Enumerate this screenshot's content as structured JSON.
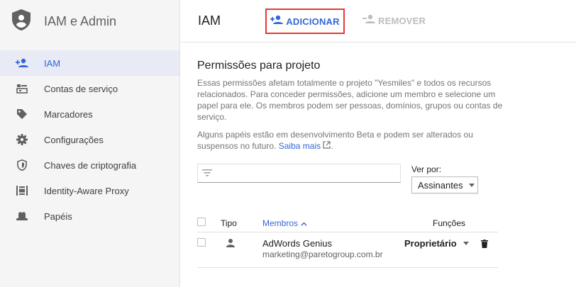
{
  "sidebar": {
    "title": "IAM e Admin",
    "items": [
      {
        "label": "IAM",
        "icon": "person-add-icon"
      },
      {
        "label": "Contas de serviço",
        "icon": "service-account-icon"
      },
      {
        "label": "Marcadores",
        "icon": "label-icon"
      },
      {
        "label": "Configurações",
        "icon": "gear-icon"
      },
      {
        "label": "Chaves de criptografia",
        "icon": "shield-icon"
      },
      {
        "label": "Identity-Aware Proxy",
        "icon": "proxy-icon"
      },
      {
        "label": "Papéis",
        "icon": "hat-icon"
      }
    ]
  },
  "header": {
    "title": "IAM",
    "add_label": "ADICIONAR",
    "remove_label": "REMOVER"
  },
  "main": {
    "section_title": "Permissões para projeto",
    "description": "Essas permissões afetam totalmente o projeto \"Yesmiles\" e todos os recursos relacionados. Para conceder permissões, adicione um membro e selecione um papel para ele. Os membros podem ser pessoas, domínios, grupos ou contas de serviço.",
    "beta_note": "Alguns papéis estão em desenvolvimento Beta e podem ser alterados ou suspensos no futuro.",
    "learn_more": "Saiba mais",
    "view_by_label": "Ver por:",
    "view_by_value": "Assinantes"
  },
  "table": {
    "columns": {
      "type": "Tipo",
      "members": "Membros",
      "roles": "Funções"
    },
    "rows": [
      {
        "name": "AdWords Genius",
        "email": "marketing@paretogroup.com.br",
        "role": "Proprietário"
      }
    ]
  },
  "colors": {
    "accent": "#3367d6",
    "highlight_border": "#e53935",
    "disabled": "#bdbdbd"
  }
}
